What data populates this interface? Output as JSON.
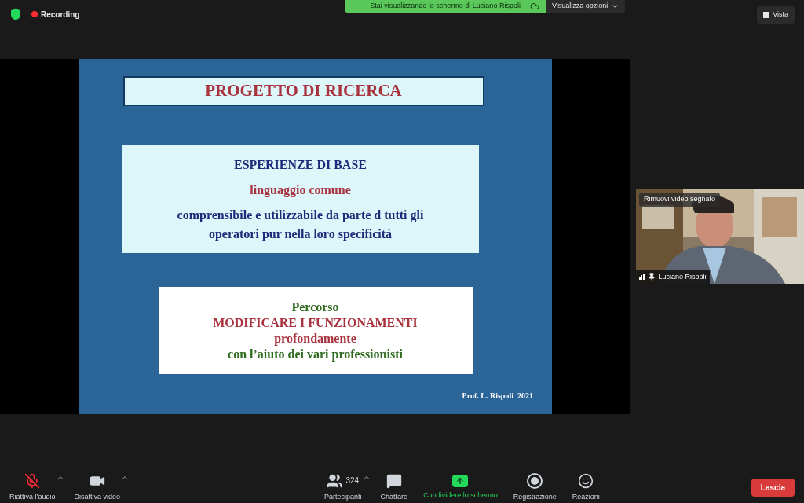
{
  "top_bar": {
    "recording": "Recording",
    "share_banner": "Stai visualizzando lo schermo di Luciano Rispoli",
    "view_options": "Visualizza opzioni",
    "view": "Vista"
  },
  "slide": {
    "title": "PROGETTO DI RICERCA",
    "box_1": [
      {
        "text": "ESPERIENZE DI BASE",
        "color": "#1f2a7a"
      },
      {
        "text": "linguaggio comune",
        "color": "#a8323e"
      },
      {
        "text": "comprensibile e utilizzabile da parte d tutti gli operatori pur nella loro specificità",
        "color": "#1f2a7a"
      }
    ],
    "box_2": [
      {
        "text": "Percorso",
        "color": "#2e6b1f"
      },
      {
        "text": "MODIFICARE I FUNZIONAMENTI",
        "color": "#a8323e"
      },
      {
        "text": "profondamente",
        "color": "#a8323e"
      },
      {
        "text": "con l’aiuto dei vari professionisti",
        "color": "#2e6b1f"
      }
    ],
    "footer": "Prof. L. Rispoli  2021"
  },
  "video_tile": {
    "kind": "picture",
    "badge": "Rimuovi video segnato",
    "name": "Luciano Rispoli"
  },
  "toolbar": {
    "left": [
      {
        "label": "Riattiva l’audio",
        "kind": "mic",
        "muted": true
      },
      {
        "label": "Disattiva video",
        "kind": "camera",
        "muted": false
      }
    ],
    "center": [
      {
        "label": "Partecipanti",
        "kind": "participants",
        "count": "324"
      },
      {
        "label": "Chattare",
        "kind": "chat"
      },
      {
        "label": "Condividere lo schermo",
        "kind": "share"
      },
      {
        "label": "Registrazione",
        "kind": "record"
      },
      {
        "label": "Reazioni",
        "kind": "reactions"
      }
    ],
    "leave": "Lascia"
  }
}
